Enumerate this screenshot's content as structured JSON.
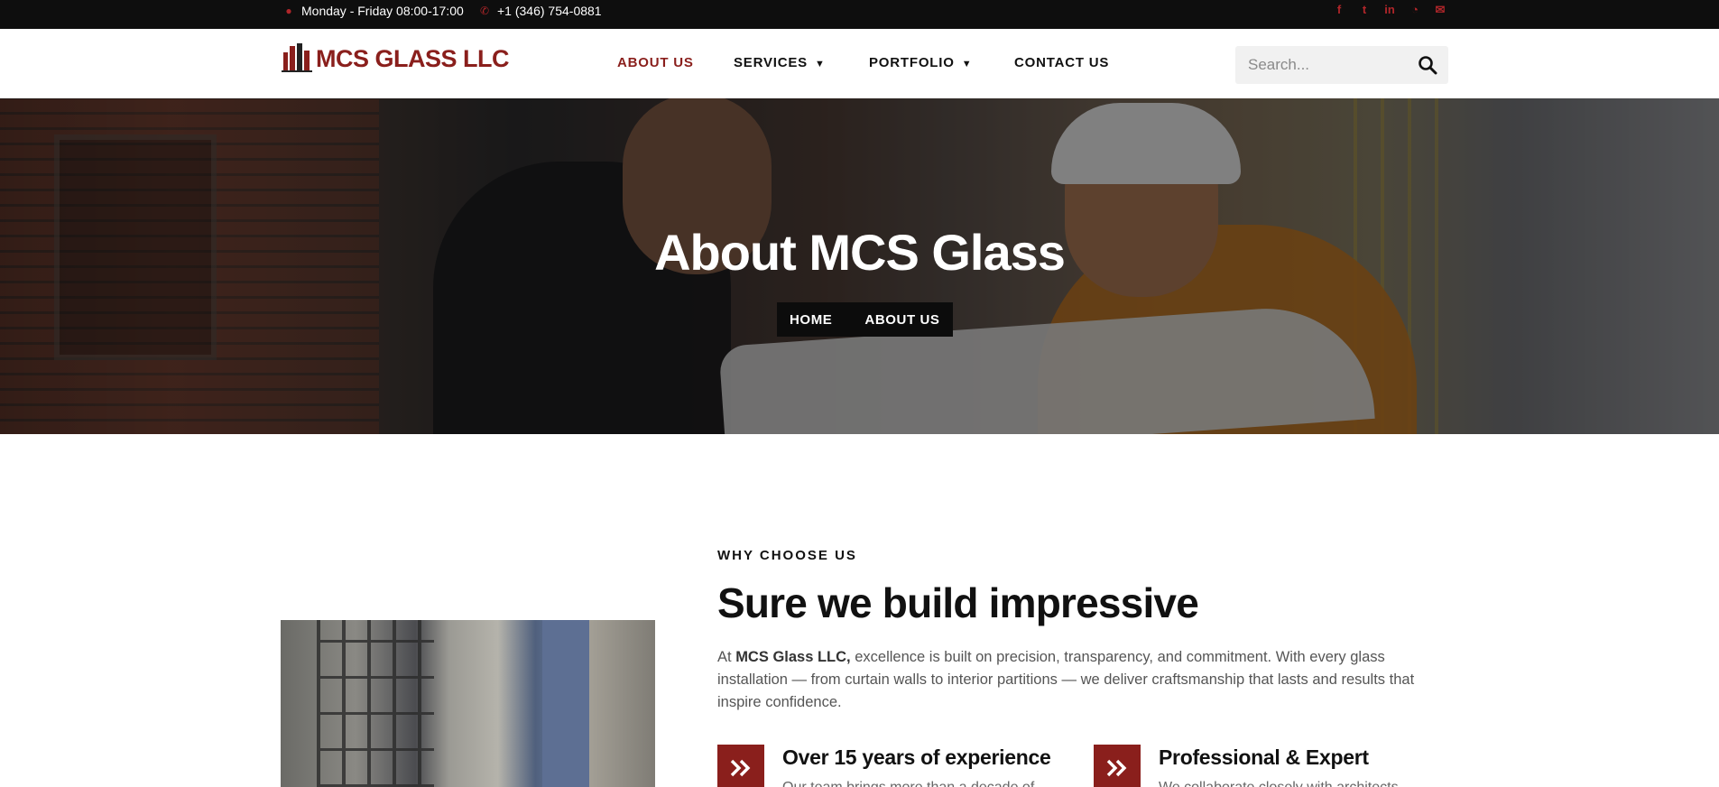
{
  "topbar": {
    "hours": "Monday - Friday 08:00-17:00",
    "phone": "+1 (346) 754-0881",
    "social_icons": [
      "facebook-icon",
      "twitter-icon",
      "linkedin-icon",
      "rss-icon",
      "email-icon"
    ]
  },
  "header": {
    "logo_text": "MCS GLASS LLC",
    "nav": [
      {
        "label": "ABOUT US",
        "active": true
      },
      {
        "label": "SERVICES",
        "dropdown": true
      },
      {
        "label": "PORTFOLIO",
        "dropdown": true
      },
      {
        "label": "CONTACT US"
      }
    ],
    "search_placeholder": "Search..."
  },
  "hero": {
    "title": "About MCS Glass",
    "breadcrumbs": [
      "HOME",
      "ABOUT US"
    ]
  },
  "about": {
    "eyebrow": "WHY CHOOSE US",
    "headline": "Sure we build impressive",
    "para_prefix": "At ",
    "para_bold": "MCS Glass LLC,",
    "para_rest": " excellence is built on precision, transparency, and commitment. With every glass installation — from curtain walls to interior partitions — we deliver craftsmanship that lasts and results that inspire confidence.",
    "features": [
      {
        "title": "Over 15 years of experience",
        "sub": "Our team brings more than a decade of"
      },
      {
        "title": "Professional & Expert",
        "sub": "We collaborate closely with architects"
      }
    ]
  },
  "colors": {
    "brand": "#8a1f1c",
    "topbar": "#0e0e0e",
    "accent_icon": "#b0262a"
  }
}
